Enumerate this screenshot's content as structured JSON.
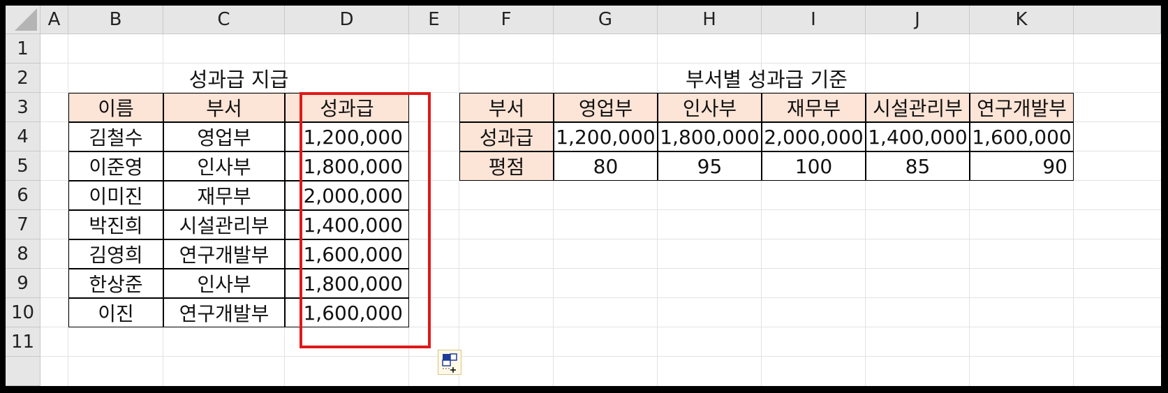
{
  "columns": [
    "A",
    "B",
    "C",
    "D",
    "E",
    "F",
    "G",
    "H",
    "I",
    "J",
    "K"
  ],
  "rows": [
    "1",
    "2",
    "3",
    "4",
    "5",
    "6",
    "7",
    "8",
    "9",
    "10",
    "11"
  ],
  "left_table": {
    "title": "성과급 지급",
    "headers": [
      "이름",
      "부서",
      "성과급"
    ],
    "rows": [
      [
        "김철수",
        "영업부",
        "1,200,000"
      ],
      [
        "이준영",
        "인사부",
        "1,800,000"
      ],
      [
        "이미진",
        "재무부",
        "2,000,000"
      ],
      [
        "박진희",
        "시설관리부",
        "1,400,000"
      ],
      [
        "김영희",
        "연구개발부",
        "1,600,000"
      ],
      [
        "한상준",
        "인사부",
        "1,800,000"
      ],
      [
        "이진",
        "연구개발부",
        "1,600,000"
      ]
    ]
  },
  "right_table": {
    "title": "부서별 성과급 기준",
    "headers": [
      "부서",
      "영업부",
      "인사부",
      "재무부",
      "시설관리부",
      "연구개발부"
    ],
    "bonus_row": [
      "성과급",
      "1,200,000",
      "1,800,000",
      "2,000,000",
      "1,400,000",
      "1,600,000"
    ],
    "score_row": [
      "평점",
      "80",
      "95",
      "100",
      "85",
      "90"
    ]
  },
  "colors": {
    "header_fill": "#fce4d6",
    "selection_border": "#e01919",
    "grid_header": "#e6e6e6"
  },
  "icons": {
    "quick_analysis": "quick-analysis-icon",
    "select_all": "select-all-triangle"
  }
}
